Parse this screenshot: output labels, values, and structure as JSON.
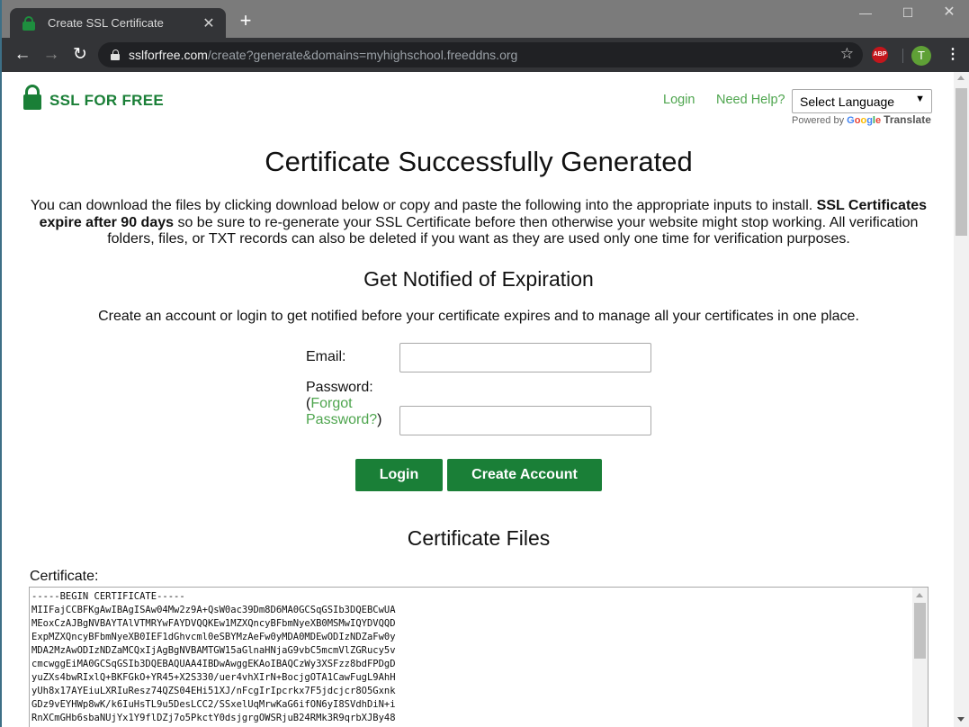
{
  "browser": {
    "tab_title": "Create SSL Certificate",
    "tab_close_glyph": "✕",
    "new_tab_glyph": "+",
    "window_controls": {
      "minimize": "—",
      "maximize": "☐",
      "close": "✕"
    },
    "nav": {
      "back": "←",
      "forward": "→",
      "reload": "↻"
    },
    "url_host": "sslforfree.com",
    "url_path": "/create?generate&domains=myhighschool.freeddns.org",
    "bookmark_glyph": "☆",
    "extension_abp": "ABP",
    "profile_initial": "T",
    "menu_glyph": "⋮"
  },
  "header": {
    "logo_text": "SSL FOR FREE",
    "login_link": "Login",
    "help_link": "Need Help?",
    "language_select": {
      "selected": "Select Language",
      "arrow": "▼"
    },
    "powered_by": "Powered by",
    "google_letters": [
      "G",
      "o",
      "o",
      "g",
      "l",
      "e"
    ],
    "translate": "Translate"
  },
  "main": {
    "title": "Certificate Successfully Generated",
    "intro": {
      "part1": "You can download the files by clicking download below or copy and paste the following into the appropriate inputs to install. ",
      "bold": "SSL Certificates expire after 90 days",
      "part2": " so be sure to re-generate your SSL Certificate before then otherwise your website might stop working. All verification folders, files, or TXT records can also be deleted if you want as they are used only one time for verification purposes."
    },
    "notify": {
      "heading": "Get Notified of Expiration",
      "text": "Create an account or login to get notified before your certificate expires and to manage all your certificates in one place.",
      "email_label": "Email:",
      "email_value": "",
      "password_label": "Password:",
      "forgot_open": "(",
      "forgot_link": "Forgot Password?",
      "forgot_close": ")",
      "password_value": "",
      "login_button": "Login",
      "create_button": "Create Account"
    },
    "files": {
      "heading": "Certificate Files",
      "certificate_label": "Certificate:",
      "certificate_lines": [
        "-----BEGIN CERTIFICATE-----",
        "MIIFajCCBFKgAwIBAgISAw04Mw2z9A+QsW0ac39Dm8D6MA0GCSqGSIb3DQEBCwUA",
        "MEoxCzAJBgNVBAYTAlVTMRYwFAYDVQQKEw1MZXQncyBFbmNyeXB0MSMwIQYDVQQD",
        "ExpMZXQncyBFbmNyeXB0IEF1dGhvcml0eSBYMzAeFw0yMDA0MDEwODIzNDZaFw0y",
        "MDA2MzAwODIzNDZaMCQxIjAgBgNVBAMTGW15aGlnaHNjaG9vbC5mcmVlZGRucy5v",
        "cmcwggEiMA0GCSqGSIb3DQEBAQUAA4IBDwAwggEKAoIBAQCzWy3XSFzz8bdFPDgD",
        "yuZXs4bwRIxlQ+BKFGkO+YR45+X2S330/uer4vhXIrN+BocjgOTA1CawFugL9AhH",
        "yUh8x17AYEiuLXRIuResz74QZS04EHi51XJ/nFcgIrIpcrkx7F5jdcjcr8O5Gxnk",
        "GDz9vEYHWp8wK/k6IuHsTL9u5DesLCC2/SSxelUqMrwKaG6ifON6yI8SVdhDiN+i",
        "RnXCmGHb6sbaNUjYx1Y9flDZj7o5PkctY0dsjgrgOWSRjuB24RMk3R9qrbXJBy48"
      ]
    }
  },
  "colors": {
    "brand_green": "#1a7f37",
    "link_green": "#4ea54e",
    "browser_dark": "#333437",
    "titlebar_gray": "#7b7b7b",
    "abp_red": "#c4161c",
    "avatar_green": "#5fa036"
  }
}
